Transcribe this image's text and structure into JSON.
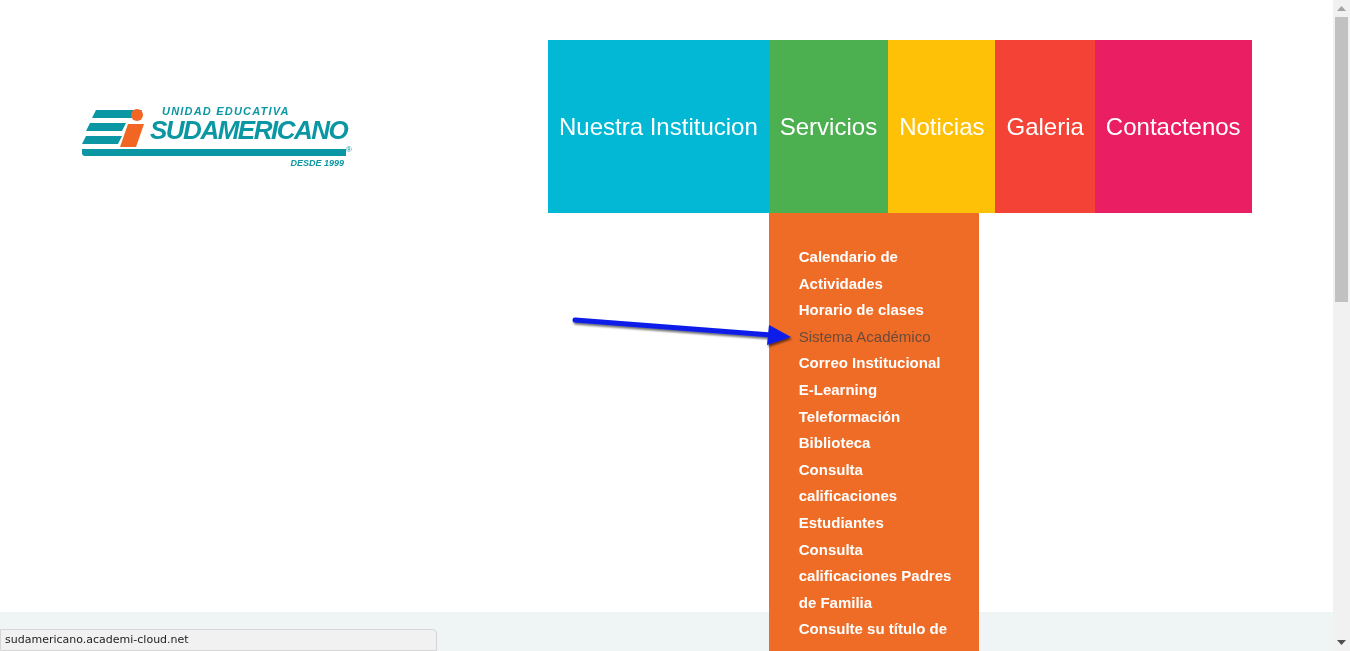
{
  "logo": {
    "top_line": "UNIDAD EDUCATIVA",
    "name": "SUDAMERICANO",
    "registered": "®",
    "since": "DESDE 1999"
  },
  "nav": [
    {
      "label": "Nuestra Institucion",
      "color": "#03b8d4"
    },
    {
      "label": "Servicios",
      "color": "#4caf50",
      "menu": [
        {
          "label": "Calendario de Actividades",
          "selected": false
        },
        {
          "label": "Horario de clases",
          "selected": false
        },
        {
          "label": "Sistema Académico",
          "selected": true
        },
        {
          "label": "Correo Institucional",
          "selected": false
        },
        {
          "label": "E-Learning",
          "selected": false
        },
        {
          "label": "Teleformación",
          "selected": false
        },
        {
          "label": "Biblioteca",
          "selected": false
        },
        {
          "label": "Consulta calificaciones Estudiantes",
          "selected": false
        },
        {
          "label": "Consulta calificaciones Padres de Familia",
          "selected": false
        },
        {
          "label": "Consulte su título de",
          "selected": false
        }
      ]
    },
    {
      "label": "Noticias",
      "color": "#ffc107"
    },
    {
      "label": "Galeria",
      "color": "#f44336"
    },
    {
      "label": "Contactenos",
      "color": "#e91e63"
    }
  ],
  "status_bar": {
    "url": "sudamericano.academi-cloud.net"
  }
}
